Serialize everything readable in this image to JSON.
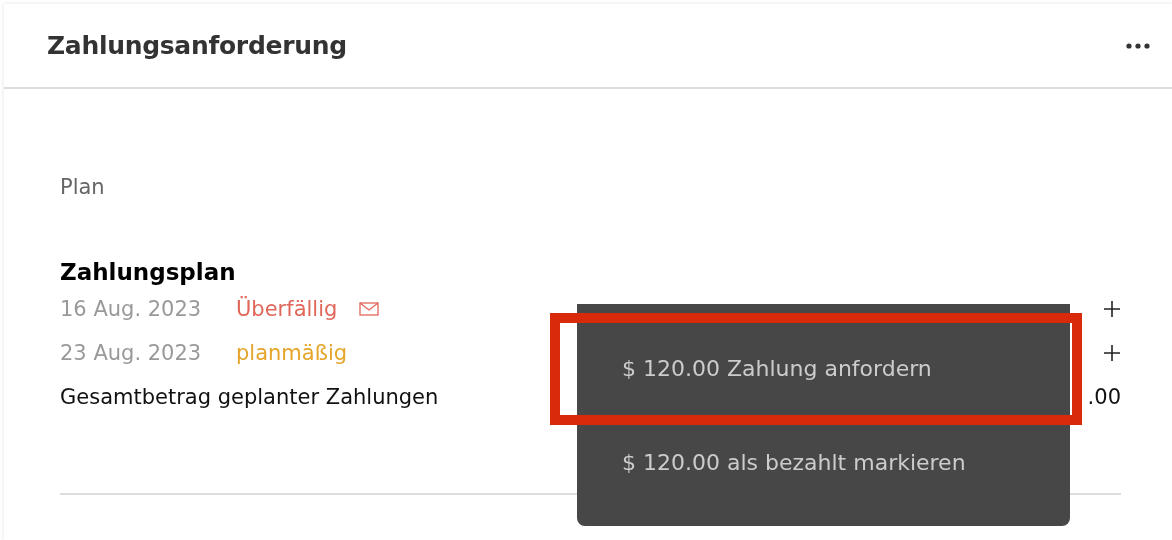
{
  "panel": {
    "title": "Zahlungsanforderung",
    "section_label": "Plan",
    "plan_title": "Zahlungsplan",
    "payments": [
      {
        "date": "16 Aug. 2023",
        "status": "Überfällig",
        "color": "#e0665a",
        "notified": true
      },
      {
        "date": "23 Aug. 2023",
        "status": "planmäßig",
        "color": "#e5a52a",
        "notified": false
      }
    ],
    "total": {
      "label": "Gesamtbetrag geplanter Zahlungen",
      "amount": ".00"
    }
  },
  "menu": {
    "items": [
      {
        "label": "$ 120.00 Zahlung anfordern",
        "highlighted": true
      },
      {
        "label": "$ 120.00 als bezahlt markieren",
        "highlighted": false
      }
    ]
  }
}
